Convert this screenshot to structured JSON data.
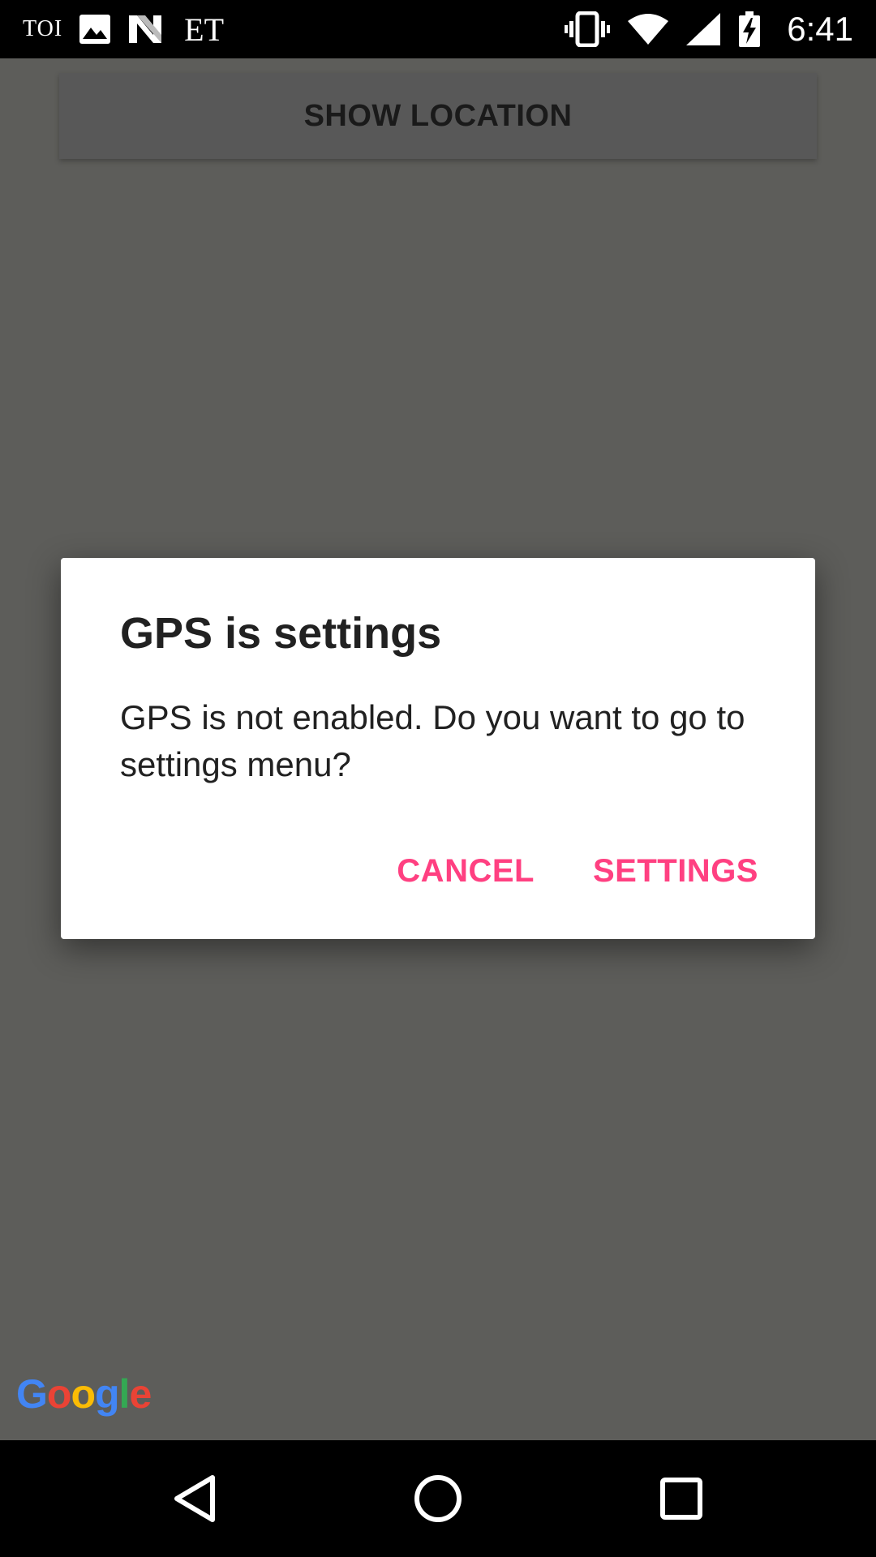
{
  "status_bar": {
    "notifications": {
      "toi": "TOI",
      "et": "ET",
      "icons": [
        "image-icon",
        "n-app-icon"
      ]
    },
    "time": "6:41",
    "icons": [
      "vibrate-icon",
      "wifi-icon",
      "signal-icon",
      "battery-charging-icon"
    ]
  },
  "app": {
    "show_location_label": "SHOW LOCATION",
    "google_logo": {
      "letters": [
        "G",
        "o",
        "o",
        "g",
        "l",
        "e"
      ],
      "colors": [
        "#4285F4",
        "#EA4335",
        "#FBBC05",
        "#4285F4",
        "#34A853",
        "#EA4335"
      ]
    }
  },
  "dialog": {
    "title": "GPS is settings",
    "message": "GPS is not enabled. Do you want to go to settings menu?",
    "cancel_label": "CANCEL",
    "settings_label": "SETTINGS",
    "accent_color": "#FF4081"
  },
  "nav_bar": {
    "icons": [
      "back-icon",
      "home-icon",
      "recents-icon"
    ]
  }
}
